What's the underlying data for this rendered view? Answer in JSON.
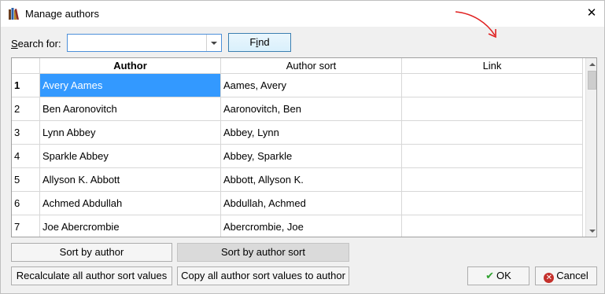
{
  "window": {
    "title": "Manage authors"
  },
  "search": {
    "label": "Search for:",
    "label_accel": "S",
    "label_rest": "earch for:",
    "value": "",
    "find_label": "Find",
    "find_accel": "i"
  },
  "table": {
    "columns": [
      "Author",
      "Author sort",
      "Link"
    ],
    "rows": [
      {
        "num": "1",
        "author": "Avery Aames",
        "sort": "Aames, Avery",
        "link": ""
      },
      {
        "num": "2",
        "author": "Ben Aaronovitch",
        "sort": "Aaronovitch, Ben",
        "link": ""
      },
      {
        "num": "3",
        "author": "Lynn Abbey",
        "sort": "Abbey, Lynn",
        "link": ""
      },
      {
        "num": "4",
        "author": "Sparkle Abbey",
        "sort": "Abbey, Sparkle",
        "link": ""
      },
      {
        "num": "5",
        "author": "Allyson K. Abbott",
        "sort": "Abbott, Allyson K.",
        "link": ""
      },
      {
        "num": "6",
        "author": "Achmed Abdullah",
        "sort": "Abdullah, Achmed",
        "link": ""
      },
      {
        "num": "7",
        "author": "Joe Abercrombie",
        "sort": "Abercrombie, Joe",
        "link": ""
      }
    ]
  },
  "buttons": {
    "sort_by_author": "Sort by author",
    "sort_by_author_sort": "Sort by author sort",
    "recalculate": "Recalculate all author sort values",
    "copy": "Copy all author sort values to author",
    "ok": "OK",
    "cancel": "Cancel"
  },
  "colors": {
    "selection": "#3399ff",
    "annotation_arrow": "#e02020",
    "ok_check": "#2fa12f",
    "cancel_icon": "#c4302b"
  },
  "icons": {
    "app": "books-icon",
    "close": "close-icon",
    "annotation": "red-arrow-annotation"
  }
}
